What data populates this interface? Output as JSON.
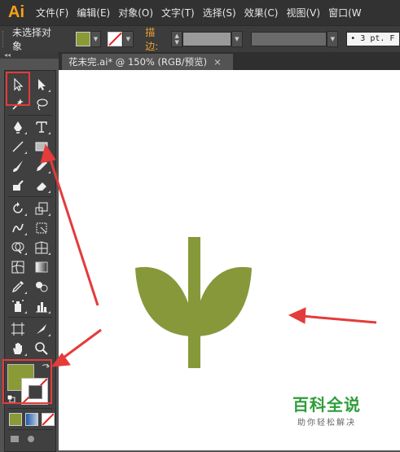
{
  "app": {
    "logo": "Ai"
  },
  "menu": {
    "items": [
      "文件(F)",
      "编辑(E)",
      "对象(O)",
      "文字(T)",
      "选择(S)",
      "效果(C)",
      "视图(V)",
      "窗口(W"
    ]
  },
  "control_bar": {
    "selection_label": "未选择对象",
    "stroke_label": "描边:",
    "profile_value": "• 3 pt. F",
    "fill_color": "#8a9a36",
    "stroke_color": "none"
  },
  "panel": {
    "collapse_label": "◂◂"
  },
  "document": {
    "tab_title": "花未完.ai* @ 150% (RGB/预览)",
    "close": "×"
  },
  "artwork": {
    "color": "#86983a"
  },
  "watermark": {
    "title": "百科全说",
    "subtitle": "助你轻松解决"
  },
  "annotation_color": "#e43b3b"
}
